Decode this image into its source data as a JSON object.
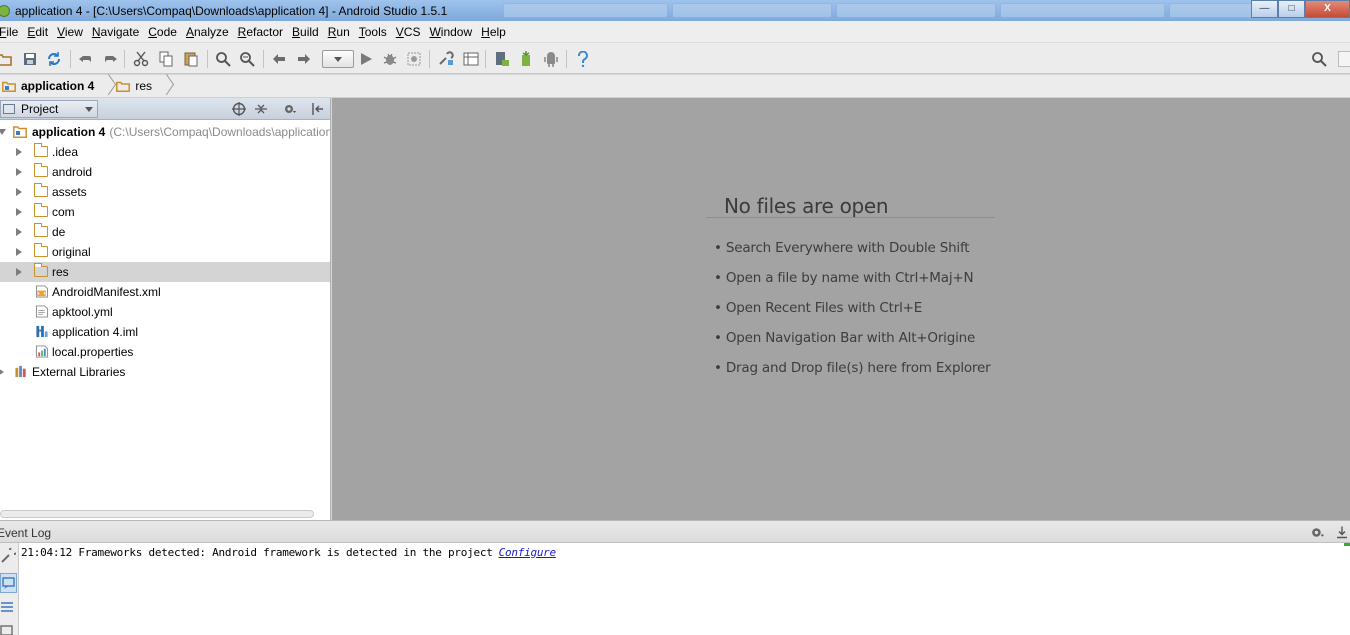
{
  "window": {
    "title": "application 4 - [C:\\Users\\Compaq\\Downloads\\application 4] - Android Studio 1.5.1",
    "minimize": "—",
    "maximize": "□",
    "close": "X"
  },
  "menu": [
    "File",
    "Edit",
    "View",
    "Navigate",
    "Code",
    "Analyze",
    "Refactor",
    "Build",
    "Run",
    "Tools",
    "VCS",
    "Window",
    "Help"
  ],
  "breadcrumb": [
    {
      "label": "application 4",
      "bold": true
    },
    {
      "label": "res",
      "bold": false
    }
  ],
  "project_panel": {
    "view_mode": "Project",
    "tree": [
      {
        "label": "application 4",
        "path": "(C:\\Users\\Compaq\\Downloads\\application",
        "type": "module",
        "expanded": true,
        "level": 0
      },
      {
        "label": ".idea",
        "type": "folder",
        "level": 1
      },
      {
        "label": "android",
        "type": "folder",
        "level": 1
      },
      {
        "label": "assets",
        "type": "folder",
        "level": 1
      },
      {
        "label": "com",
        "type": "folder",
        "level": 1
      },
      {
        "label": "de",
        "type": "folder",
        "level": 1
      },
      {
        "label": "original",
        "type": "folder",
        "level": 1
      },
      {
        "label": "res",
        "type": "folder",
        "level": 1,
        "selected": true
      },
      {
        "label": "AndroidManifest.xml",
        "type": "xml-file",
        "level": 1
      },
      {
        "label": "apktool.yml",
        "type": "text-file",
        "level": 1
      },
      {
        "label": "application 4.iml",
        "type": "iml-file",
        "level": 1
      },
      {
        "label": "local.properties",
        "type": "properties-file",
        "level": 1
      },
      {
        "label": "External Libraries",
        "type": "libraries",
        "level": 0
      }
    ]
  },
  "editor": {
    "empty_title": "No files are open",
    "hints": [
      "• Search Everywhere with Double Shift",
      "• Open a file by name with Ctrl+Maj+N",
      "• Open Recent Files with Ctrl+E",
      "• Open Navigation Bar with Alt+Origine",
      "• Drag and Drop file(s) here from Explorer"
    ]
  },
  "event_log": {
    "title": "Event Log",
    "entries": [
      {
        "text": "21:04:12 Frameworks detected: Android framework is detected in the project",
        "link": "Configure"
      }
    ]
  },
  "colors": {
    "editor_bg": "#a3a3a3",
    "folder": "#c9922c",
    "link": "#1a1acc",
    "run_green": "#3ca83c"
  }
}
